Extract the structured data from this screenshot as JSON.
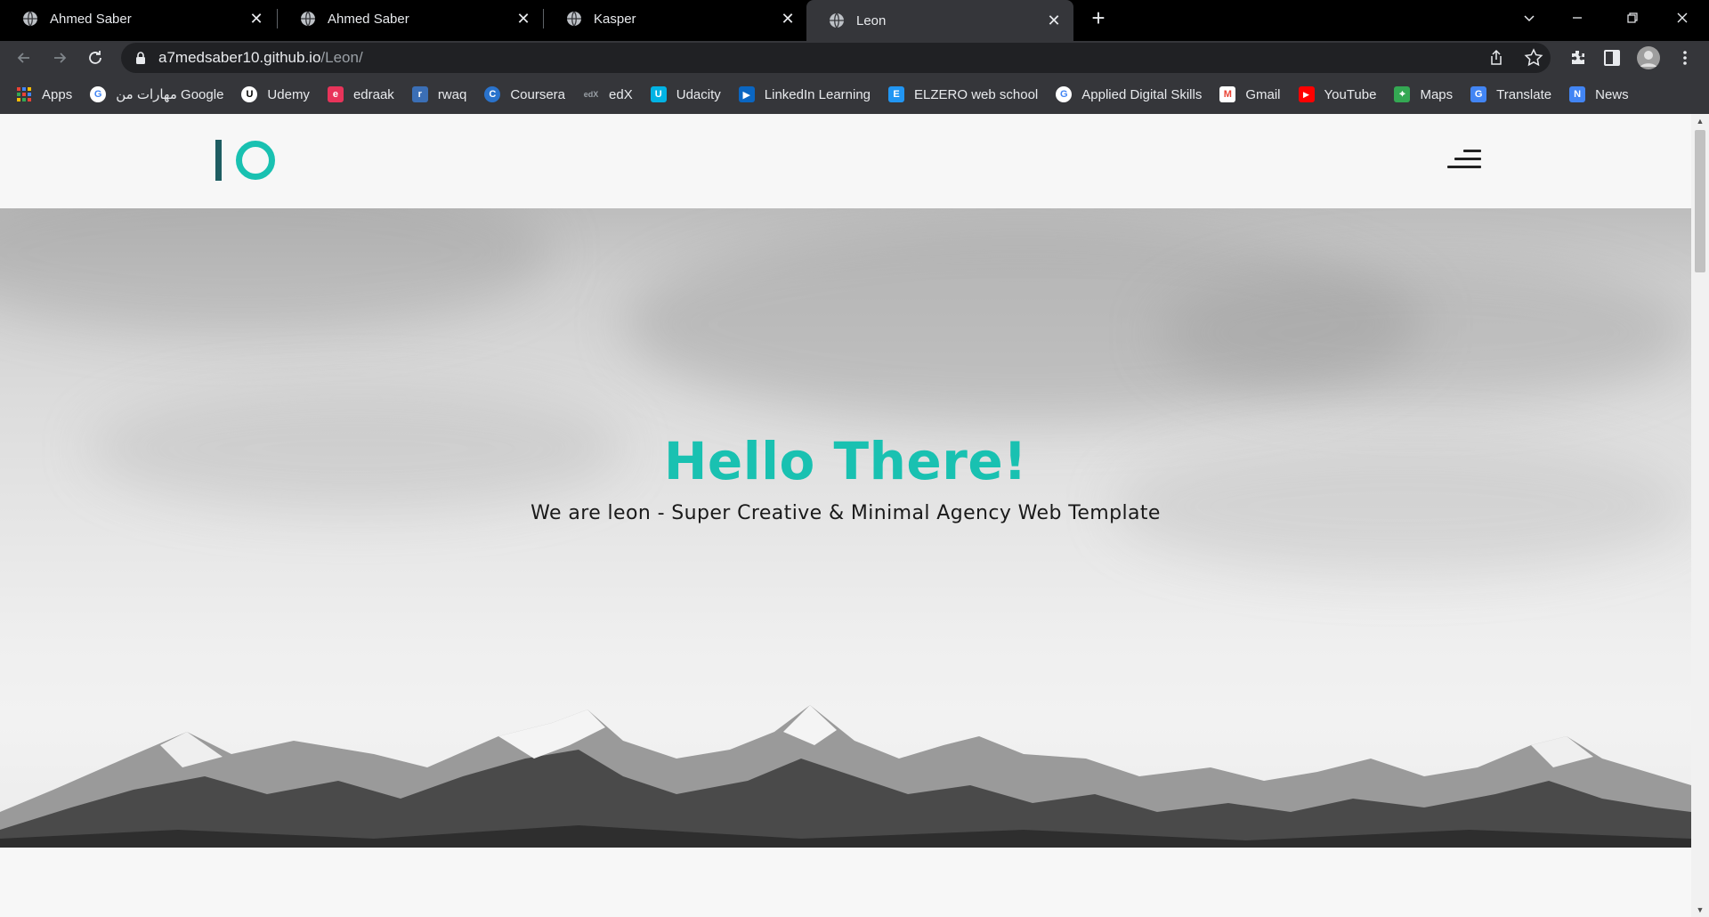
{
  "browser": {
    "tabs": [
      {
        "title": "Ahmed Saber",
        "active": false
      },
      {
        "title": "Ahmed Saber",
        "active": false
      },
      {
        "title": "Kasper",
        "active": false
      },
      {
        "title": "Leon",
        "active": true
      }
    ],
    "url_host": "a7medsaber10.github.io",
    "url_path": "/Leon/",
    "bookmarks": [
      {
        "label": "Apps",
        "icon": "apps-grid-icon",
        "color": "#4285f4"
      },
      {
        "label": "مهارات من Google",
        "icon": "google-icon",
        "color": "#ffffff"
      },
      {
        "label": "Udemy",
        "icon": "udemy-icon",
        "color": "#ffffff"
      },
      {
        "label": "edraak",
        "icon": "edraak-icon",
        "color": "#e8345a"
      },
      {
        "label": "rwaq",
        "icon": "rwaq-icon",
        "color": "#3b6fb6"
      },
      {
        "label": "Coursera",
        "icon": "coursera-icon",
        "color": "#2a73cc"
      },
      {
        "label": "edX",
        "icon": "edx-icon",
        "color": "#35363a"
      },
      {
        "label": "Udacity",
        "icon": "udacity-icon",
        "color": "#02b3e4"
      },
      {
        "label": "LinkedIn Learning",
        "icon": "linkedin-learning-icon",
        "color": "#0a66c2"
      },
      {
        "label": "ELZERO web school",
        "icon": "elzero-icon",
        "color": "#2196f3"
      },
      {
        "label": "Applied Digital Skills",
        "icon": "google-icon",
        "color": "#ffffff"
      },
      {
        "label": "Gmail",
        "icon": "gmail-icon",
        "color": "#ffffff"
      },
      {
        "label": "YouTube",
        "icon": "youtube-icon",
        "color": "#ff0000"
      },
      {
        "label": "Maps",
        "icon": "maps-icon",
        "color": "#34a853"
      },
      {
        "label": "Translate",
        "icon": "translate-icon",
        "color": "#4285f4"
      },
      {
        "label": "News",
        "icon": "news-icon",
        "color": "#4285f4"
      }
    ]
  },
  "site": {
    "hero_title": "Hello There!",
    "hero_subtitle": "We are leon - Super Creative & Minimal Agency Web Template",
    "accent_color": "#19c1b1",
    "logo_bar_color": "#1e5d62"
  }
}
